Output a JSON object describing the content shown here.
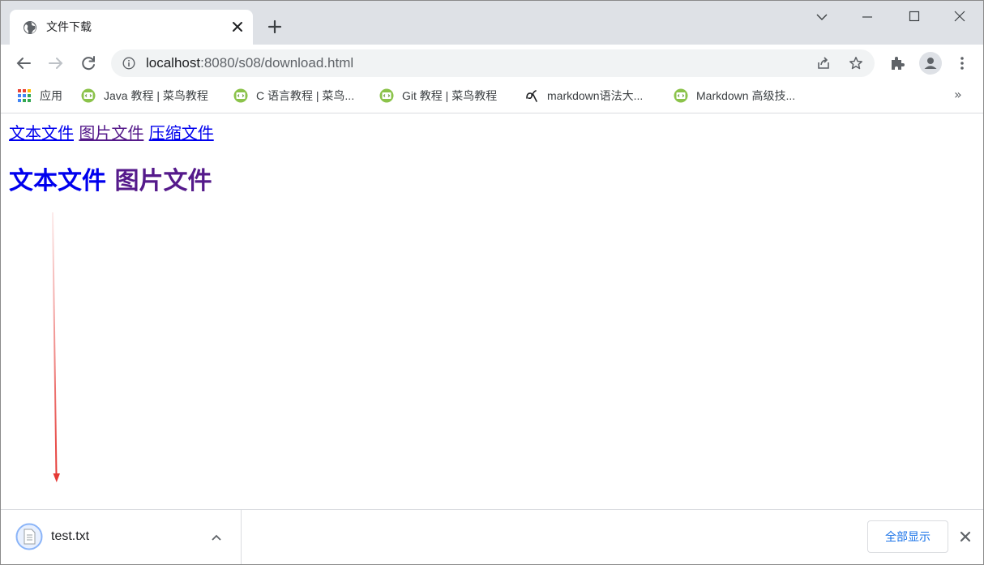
{
  "tab": {
    "title": "文件下载",
    "favicon": "globe-icon"
  },
  "address_bar": {
    "host": "localhost",
    "path": ":8080/s08/download.html"
  },
  "bookmarks": [
    {
      "label": "应用",
      "icon": "apps-grid-icon"
    },
    {
      "label": "Java 教程 | 菜鸟教程",
      "icon": "runoob-icon"
    },
    {
      "label": "C 语言教程 | 菜鸟...",
      "icon": "runoob-icon"
    },
    {
      "label": "Git 教程 | 菜鸟教程",
      "icon": "runoob-icon"
    },
    {
      "label": "markdown语法大...",
      "icon": "markdown-site-icon"
    },
    {
      "label": "Markdown 高级技...",
      "icon": "runoob-icon"
    }
  ],
  "bookmarks_overflow": "»",
  "page": {
    "links": [
      "文本文件",
      "图片文件",
      "压缩文件"
    ],
    "heading_links": [
      "文本文件",
      "图片文件"
    ]
  },
  "downloads": {
    "file_name": "test.txt",
    "show_all_label": "全部显示"
  },
  "colors": {
    "link_unvisited": "#0000ee",
    "link_visited": "#551a8b",
    "annotation_arrow": "#e53935",
    "accent": "#1a73e8"
  }
}
